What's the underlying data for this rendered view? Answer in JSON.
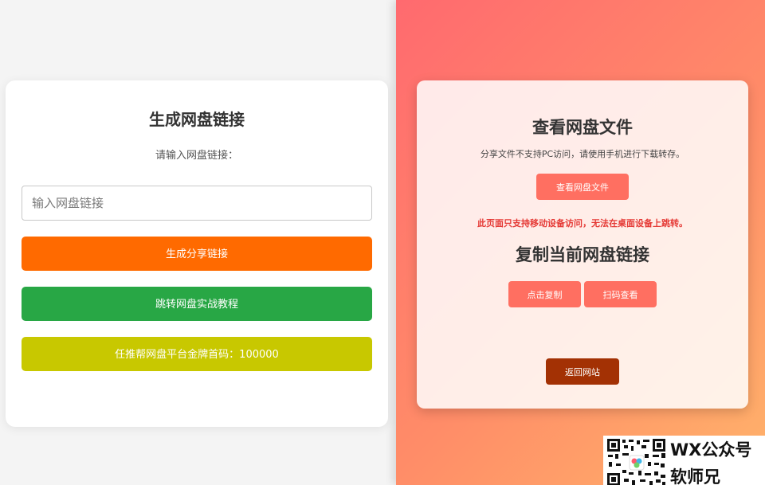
{
  "generator": {
    "title": "生成网盘链接",
    "input_label": "请输入网盘链接：",
    "input_placeholder": "输入网盘链接",
    "input_value": "",
    "generate_button": "生成分享链接",
    "tutorial_button": "跳转网盘实战教程",
    "invite_button": "任推帮网盘平台金牌首码：100000"
  },
  "viewer": {
    "title": "查看网盘文件",
    "description": "分享文件不支持PC访问，请使用手机进行下载转存。",
    "view_button": "查看网盘文件",
    "warning": "此页面只支持移动设备访问，无法在桌面设备上跳转。",
    "copy_title": "复制当前网盘链接",
    "copy_button": "点击复制",
    "scan_button": "扫码查看",
    "back_button": "返回网站"
  },
  "watermark": {
    "line1": "WX公众号",
    "line2": "软师兄",
    "icon": "qr-code-icon"
  },
  "colors": {
    "generate": "#ff6a00",
    "tutorial": "#28a745",
    "invite": "#c8c800",
    "salmon": "#ff6f61",
    "back": "#a33104",
    "warning": "#e53935"
  }
}
